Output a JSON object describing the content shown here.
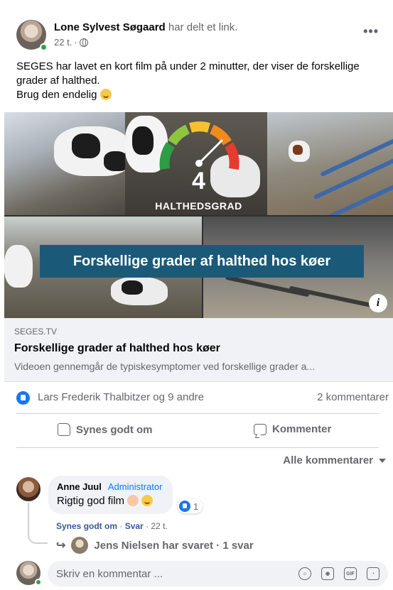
{
  "post": {
    "author": "Lone Sylvest Søgaard",
    "action": "har delt et link.",
    "time": "22 t.",
    "more_label": "•••",
    "text_line1": "SEGES har lavet en kort film på under 2 minutter, der viser de forskellige grader af halthed.",
    "text_line2": "Brug den endelig"
  },
  "media": {
    "grade_number": "4",
    "grade_label": "HALTHEDSGRAD",
    "banner_text": "Forskellige grader af halthed hos køer",
    "info_label": "i",
    "gauge_colors": [
      "#e63b2e",
      "#f28a1c",
      "#f6c12d",
      "#8cc63f",
      "#2e9d43"
    ]
  },
  "link_card": {
    "domain": "SEGES.TV",
    "title": "Forskellige grader af halthed hos køer",
    "description": "Videoen gennemgår de typiskesymptomer ved forskellige grader a..."
  },
  "reactions": {
    "names": "Lars Frederik Thalbitzer og 9 andre",
    "comments": "2 kommentarer"
  },
  "actions": {
    "like": "Synes godt om",
    "comment": "Kommenter"
  },
  "filter": {
    "label": "Alle kommentarer"
  },
  "comment": {
    "author": "Anne Juul",
    "badge": "Administrator",
    "text": "Rigtig god film",
    "reaction_count": "1",
    "like_action": "Synes godt om",
    "reply_action": "Svar",
    "time": "22 t.",
    "reply_summary": "Jens Nielsen har svaret · 1 svar"
  },
  "composer": {
    "placeholder": "Skriv en kommentar ...",
    "icons": [
      "emoji-icon",
      "camera-icon",
      "gif-icon",
      "sticker-icon"
    ],
    "gif_label": "GIF"
  },
  "colors": {
    "accent": "#1877f2",
    "banner": "#1a5a78",
    "online": "#31a24c"
  }
}
